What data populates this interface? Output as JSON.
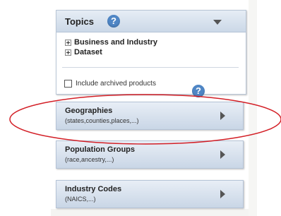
{
  "topics": {
    "title": "Topics",
    "items": [
      {
        "label": "Business and Industry"
      },
      {
        "label": "Dataset"
      }
    ],
    "archive_label": "Include archived products"
  },
  "facets": [
    {
      "title": "Geographies",
      "subtitle": "(states,counties,places,...)"
    },
    {
      "title": "Population Groups",
      "subtitle": "(race,ancestry,...)"
    },
    {
      "title": "Industry Codes",
      "subtitle": "(NAICS,...)"
    }
  ],
  "colors": {
    "panel_header": "#cbd8e7",
    "help_icon": "#4f86c5",
    "annotation_ellipse": "#d31f26"
  }
}
